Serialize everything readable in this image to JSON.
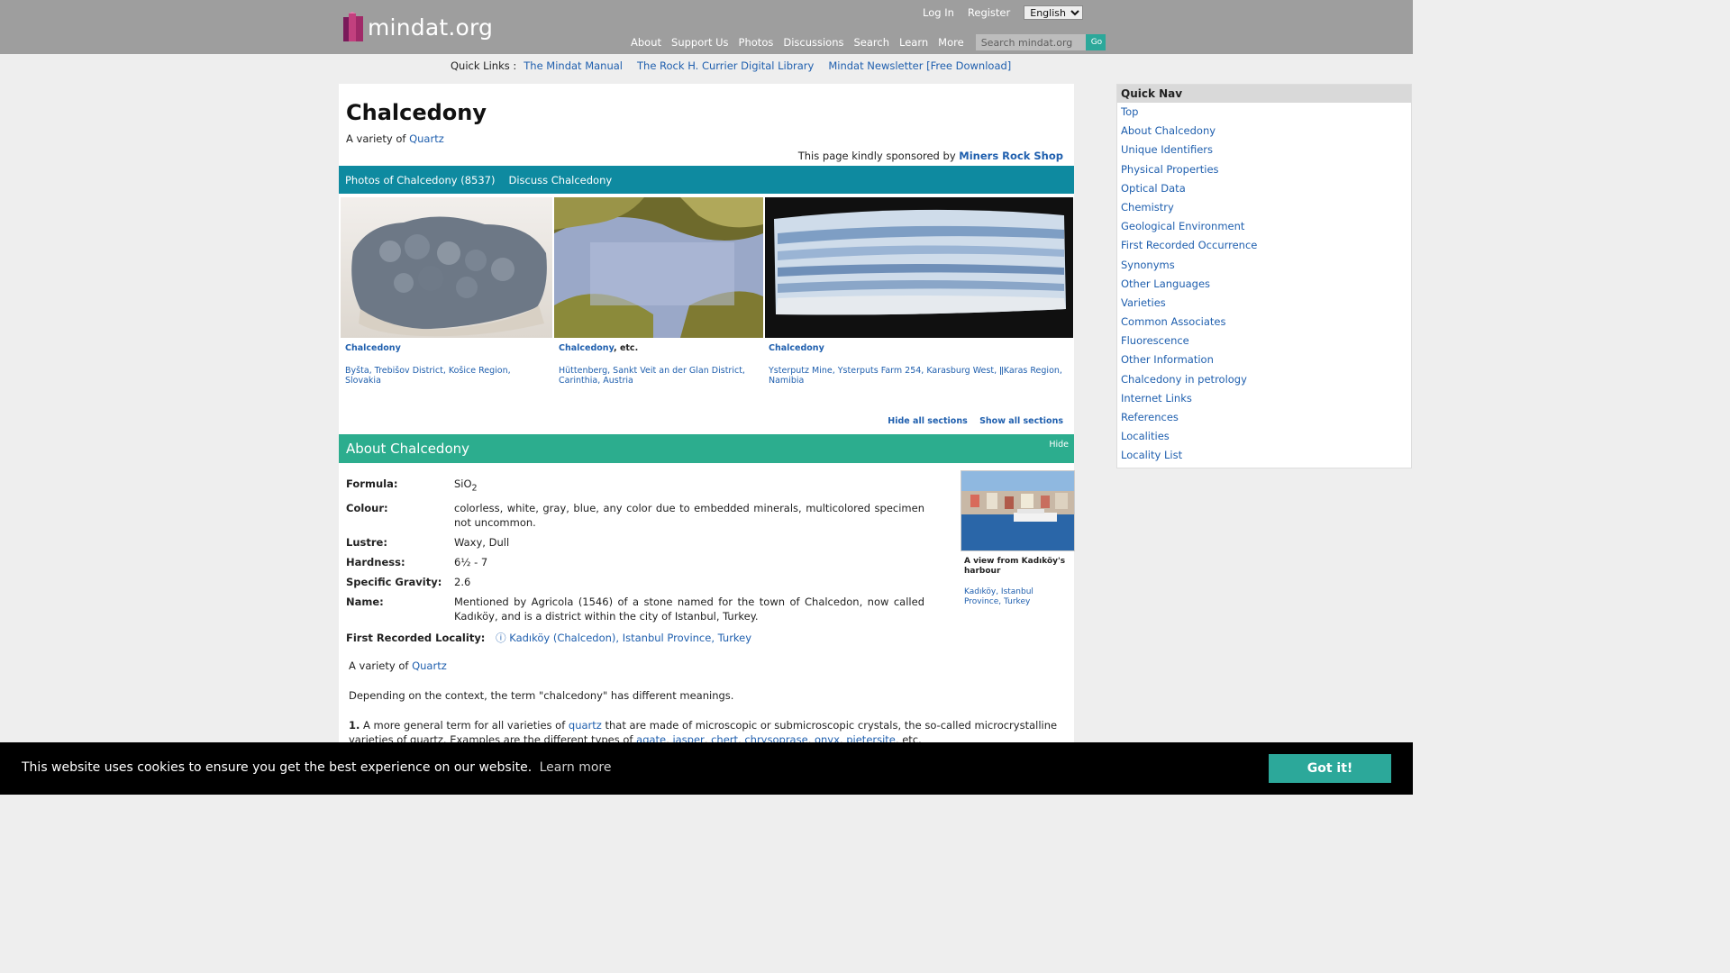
{
  "header": {
    "site_name": "mindat.org",
    "login_label": "Log In",
    "register_label": "Register",
    "language_selected": "English",
    "nav": [
      "About",
      "Support Us",
      "Photos",
      "Discussions",
      "Search",
      "Learn",
      "More"
    ],
    "search_placeholder": "Search mindat.org",
    "go_label": "Go"
  },
  "quick_links": {
    "label": "Quick Links :",
    "items": [
      "The Mindat Manual",
      "The Rock H. Currier Digital Library",
      "Mindat Newsletter [Free Download]"
    ]
  },
  "main": {
    "title": "Chalcedony",
    "variety_prefix": "A variety of",
    "variety_link": "Quartz",
    "sponsor_prefix": "This page kindly sponsored by",
    "sponsor_link": "Miners Rock Shop",
    "tabs": [
      "Photos of Chalcedony (8537)",
      "Discuss Chalcedony"
    ],
    "photos": [
      {
        "title": "Chalcedony",
        "suffix": "",
        "location": "Byšta, Trebišov District, Košice Region, Slovakia"
      },
      {
        "title": "Chalcedony",
        "suffix": ", etc.",
        "location": "Hüttenberg, Sankt Veit an der Glan District, Carinthia, Austria"
      },
      {
        "title": "Chalcedony",
        "suffix": "",
        "location": "Ysterputz Mine, Ysterputs Farm 254, Karasburg West, ǁKaras Region, Namibia"
      }
    ],
    "hide_all": "Hide all sections",
    "show_all": "Show all sections"
  },
  "about": {
    "heading": "About Chalcedony",
    "hide": "Hide",
    "formula_label": "Formula:",
    "formula_base": "SiO",
    "formula_sub": "2",
    "colour_label": "Colour:",
    "colour_value": "colorless, white, gray, blue, any color due to embedded minerals, multicolored specimen not uncommon.",
    "lustre_label": "Lustre:",
    "lustre_value": "Waxy, Dull",
    "hardness_label": "Hardness:",
    "hardness_value": "6½ - 7",
    "sg_label": "Specific Gravity:",
    "sg_value": "2.6",
    "name_label": "Name:",
    "name_value": "Mentioned by Agricola (1546) of a stone named for the town of Chalcedon, now called Kadıköy, and is a district within the city of Istanbul, Turkey.",
    "frl_label": "First Recorded Locality:",
    "frl_icon": "ⓘ",
    "frl_value": "Kadıköy (Chalcedon), Istanbul Province, Turkey",
    "side_photo_title": "A view from Kadıköy's harbour",
    "side_photo_location": "Kadıköy, Istanbul Province, Turkey",
    "para1_prefix": "A variety of",
    "para1_link": "Quartz",
    "para2": "Depending on the context, the term \"chalcedony\" has different meanings.",
    "para3_num": "1.",
    "para3_a": "A more general term for all varieties of",
    "para3_link": "quartz",
    "para3_b": "that are made of microscopic or submicroscopic crystals, the so-called microcrystalline varieties of quartz. Examples are the different types of",
    "para3_links": [
      "agate",
      "jasper",
      "chert",
      "chrysoprase",
      "onyx",
      "pietersite"
    ],
    "para3_end": ", etc."
  },
  "quicknav": {
    "heading": "Quick Nav",
    "items": [
      "Top",
      "About Chalcedony",
      "Unique Identifiers",
      "Physical Properties",
      "Optical Data",
      "Chemistry",
      "Geological Environment",
      "First Recorded Occurrence",
      "Synonyms",
      "Other Languages",
      "Varieties",
      "Common Associates",
      "Fluorescence",
      "Other Information",
      "Chalcedony in petrology",
      "Internet Links",
      "References",
      "Localities",
      "Locality List"
    ]
  },
  "cookie": {
    "message": "This website uses cookies to ensure you get the best experience on our website.",
    "learn_more": "Learn more",
    "button": "Got it!"
  }
}
